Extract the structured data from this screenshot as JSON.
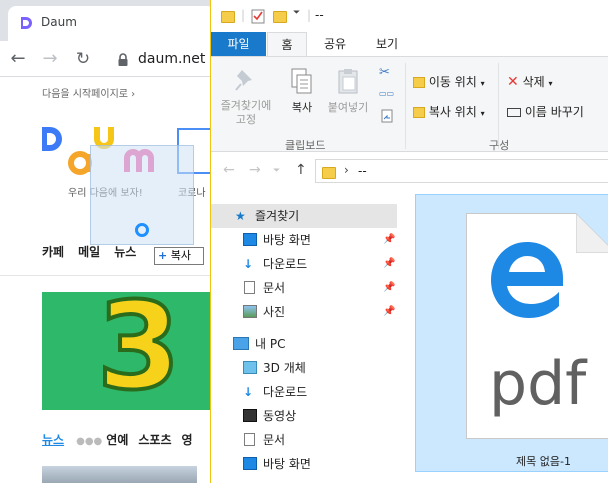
{
  "browser": {
    "tab_title": "Daum",
    "url": "daum.net",
    "startpage_link": "다음을 시작페이지로 ›",
    "slogan": "우리 다음에 보자!",
    "search_hint": "코로나",
    "menu": [
      "카페",
      "메일",
      "뉴스"
    ],
    "banner_number": "3",
    "news_tabs": [
      "뉴스",
      "연예",
      "스포츠",
      "영"
    ],
    "drag_tooltip": "복사"
  },
  "explorer": {
    "title": "--",
    "ribbon_tabs": [
      "파일",
      "홈",
      "공유",
      "보기"
    ],
    "clipboard": {
      "pin_label_1": "즐겨찾기에",
      "pin_label_2": "고정",
      "copy_label": "복사",
      "paste_label": "붙여넣기",
      "group_label": "클립보드"
    },
    "organize": {
      "move_label": "이동 위치",
      "copy_to_label": "복사 위치",
      "delete_label": "삭제",
      "rename_label": "이름 바꾸기",
      "group_label": "구성"
    },
    "address": "--",
    "nav": {
      "quick_access": "즐겨찾기",
      "quick_items": [
        "바탕 화면",
        "다운로드",
        "문서",
        "사진"
      ],
      "this_pc": "내 PC",
      "pc_items": [
        "3D 개체",
        "다운로드",
        "동영상",
        "문서",
        "바탕 화면"
      ]
    },
    "file": {
      "name": "제목 없음-1",
      "type_text": "pdf"
    }
  },
  "colors": {
    "ribbon_file_tab": "#1979ca",
    "selection": "#cce8ff",
    "edge_blue": "#1e88e5",
    "banner_green": "#2db86a",
    "banner_yellow": "#f7d21a"
  }
}
